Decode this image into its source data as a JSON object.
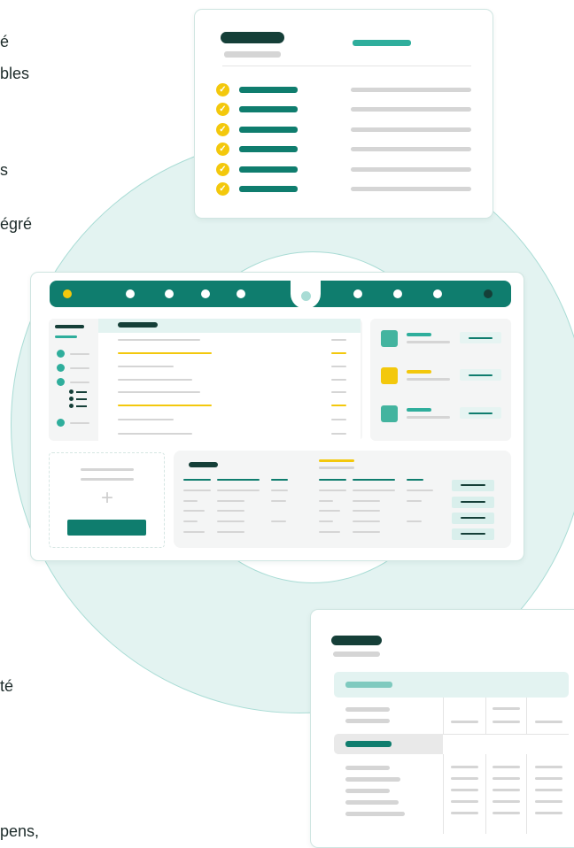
{
  "fragments": [
    "é",
    "bles",
    "s",
    "égré",
    "té",
    "pens,"
  ],
  "icons": {
    "check": "check-icon",
    "plus": "plus-icon",
    "list": "bullet-list-icon"
  },
  "glyphs": {
    "check": "✓",
    "plus": "+"
  },
  "colors": {
    "dark_green": "#153f38",
    "green": "#0f7d6e",
    "teal": "#2fae9c",
    "yellow": "#f3c80c",
    "gray": "#d5d5d5",
    "ring": "#e3f3f1"
  },
  "checklist_card": {
    "rows": 6
  },
  "dashboard": {
    "nav_dots": 8,
    "table_rows": 7,
    "metric_rows": 3
  },
  "table_card": {
    "data_rows": 4
  }
}
